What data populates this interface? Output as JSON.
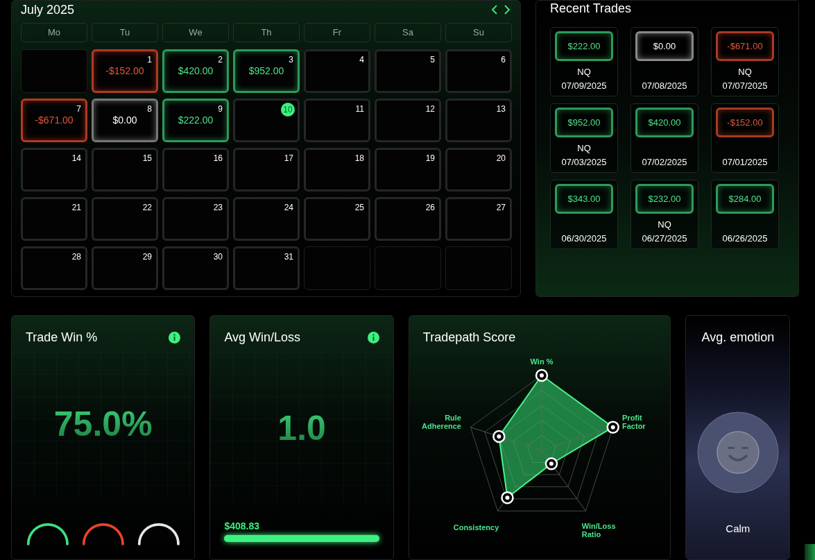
{
  "calendar": {
    "title": "July 2025",
    "weekdays": [
      "Mo",
      "Tu",
      "We",
      "Th",
      "Fr",
      "Sa",
      "Su"
    ],
    "weeks": [
      [
        {
          "kind": "blank"
        },
        {
          "kind": "loss",
          "day": "1",
          "pnl": "-$152.00",
          "today": false
        },
        {
          "kind": "win",
          "day": "2",
          "pnl": "$420.00",
          "today": false
        },
        {
          "kind": "win",
          "day": "3",
          "pnl": "$952.00",
          "today": false
        },
        {
          "kind": "plain",
          "day": "4",
          "today": false
        },
        {
          "kind": "plain",
          "day": "5",
          "today": false
        },
        {
          "kind": "plain",
          "day": "6",
          "today": false
        }
      ],
      [
        {
          "kind": "loss",
          "day": "7",
          "pnl": "-$671.00",
          "today": false
        },
        {
          "kind": "flat",
          "day": "8",
          "pnl": "$0.00",
          "today": false
        },
        {
          "kind": "win",
          "day": "9",
          "pnl": "$222.00",
          "today": false
        },
        {
          "kind": "plain",
          "day": "10",
          "today": true
        },
        {
          "kind": "plain",
          "day": "11",
          "today": false
        },
        {
          "kind": "plain",
          "day": "12",
          "today": false
        },
        {
          "kind": "plain",
          "day": "13",
          "today": false
        }
      ],
      [
        {
          "kind": "plain",
          "day": "14",
          "today": false
        },
        {
          "kind": "plain",
          "day": "15",
          "today": false
        },
        {
          "kind": "plain",
          "day": "16",
          "today": false
        },
        {
          "kind": "plain",
          "day": "17",
          "today": false
        },
        {
          "kind": "plain",
          "day": "18",
          "today": false
        },
        {
          "kind": "plain",
          "day": "19",
          "today": false
        },
        {
          "kind": "plain",
          "day": "20",
          "today": false
        }
      ],
      [
        {
          "kind": "plain",
          "day": "21",
          "today": false
        },
        {
          "kind": "plain",
          "day": "22",
          "today": false
        },
        {
          "kind": "plain",
          "day": "23",
          "today": false
        },
        {
          "kind": "plain",
          "day": "24",
          "today": false
        },
        {
          "kind": "plain",
          "day": "25",
          "today": false
        },
        {
          "kind": "plain",
          "day": "26",
          "today": false
        },
        {
          "kind": "plain",
          "day": "27",
          "today": false
        }
      ],
      [
        {
          "kind": "plain",
          "day": "28",
          "today": false
        },
        {
          "kind": "plain",
          "day": "29",
          "today": false
        },
        {
          "kind": "plain",
          "day": "30",
          "today": false
        },
        {
          "kind": "plain",
          "day": "31",
          "today": false
        },
        {
          "kind": "blank"
        },
        {
          "kind": "blank"
        },
        {
          "kind": "blank"
        }
      ]
    ]
  },
  "recent_trades": {
    "title": "Recent Trades",
    "trades": [
      {
        "amount": "$222.00",
        "kind": "win",
        "symbol": "NQ",
        "date": "07/09/2025"
      },
      {
        "amount": "$0.00",
        "kind": "flat",
        "date": "07/08/2025"
      },
      {
        "amount": "-$671.00",
        "kind": "loss",
        "symbol": "NQ",
        "date": "07/07/2025"
      },
      {
        "amount": "$952.00",
        "kind": "win",
        "symbol": "NQ",
        "date": "07/03/2025"
      },
      {
        "amount": "$420.00",
        "kind": "win",
        "date": "07/02/2025"
      },
      {
        "amount": "-$152.00",
        "kind": "loss",
        "date": "07/01/2025"
      },
      {
        "amount": "$343.00",
        "kind": "win",
        "date": "06/30/2025"
      },
      {
        "amount": "$232.00",
        "kind": "win",
        "symbol": "NQ",
        "date": "06/27/2025"
      },
      {
        "amount": "$284.00",
        "kind": "win",
        "date": "06/26/2025"
      }
    ]
  },
  "trade_win": {
    "title": "Trade Win %",
    "value": "75.0%",
    "gauges": [
      {
        "color": "#3ee07f"
      },
      {
        "color": "#e8442a"
      },
      {
        "color": "#e6e6e6"
      }
    ]
  },
  "avg_win_loss": {
    "title": "Avg Win/Loss",
    "value": "1.0",
    "bar": {
      "label": "$408.83",
      "level": 1
    }
  },
  "score": {
    "title": "Tradepath Score",
    "axes": [
      {
        "label": "Win %"
      },
      {
        "label": "Rule Adherence"
      },
      {
        "label": "Profit Factor"
      },
      {
        "label": "Consistency"
      },
      {
        "label": "Win/Loss Ratio"
      }
    ]
  },
  "emotion": {
    "title": "Avg. emotion",
    "label": "Calm"
  }
}
